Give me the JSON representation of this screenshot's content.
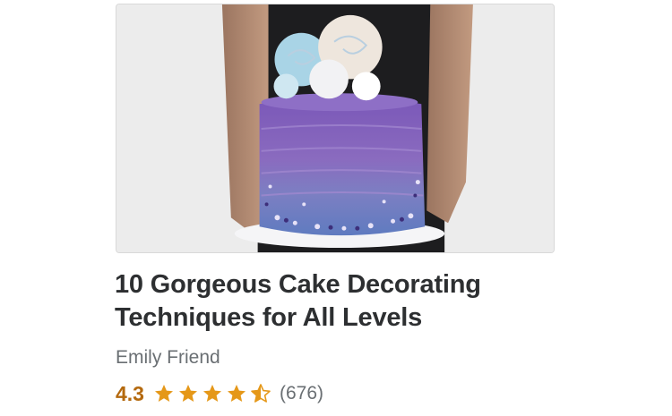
{
  "course": {
    "title": "10 Gorgeous Cake Decorating Techniques for All Levels",
    "instructor": "Emily Friend",
    "rating": "4.3",
    "rating_fraction": 0.86,
    "review_count": "(676)",
    "thumbnail_icon": "cake-photo"
  },
  "colors": {
    "title": "#2d2f31",
    "muted": "#6a6f73",
    "rating": "#b4690e",
    "star": "#e59819"
  }
}
